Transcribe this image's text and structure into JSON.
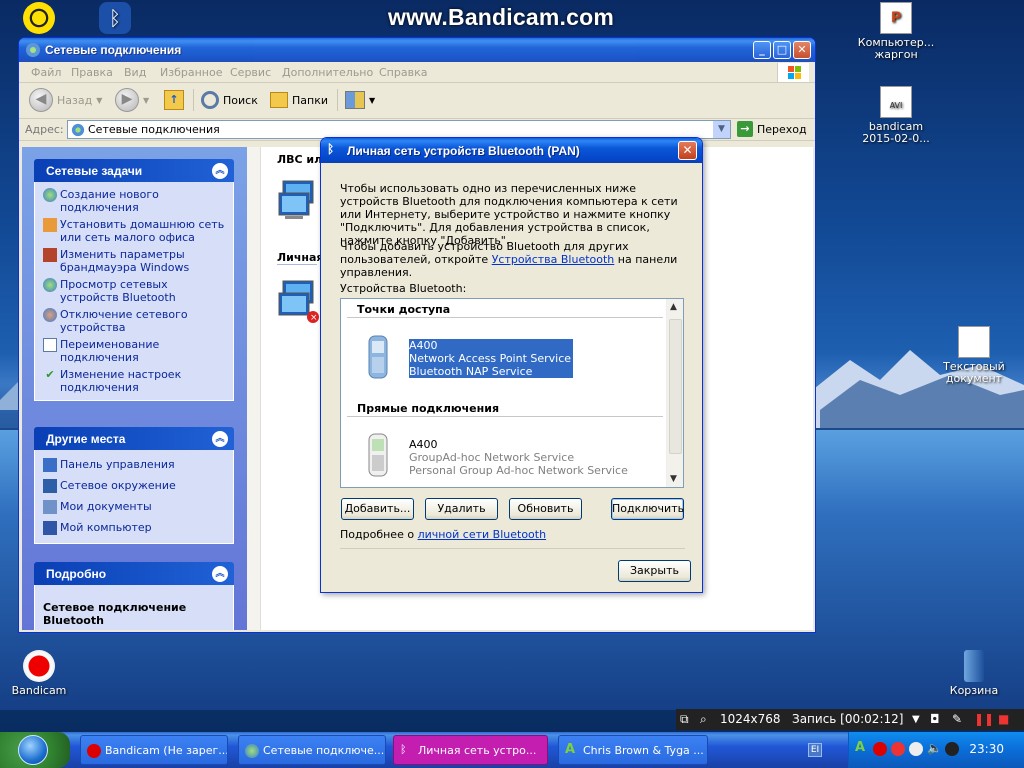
{
  "watermark": "www.Bandicam.com",
  "desktop": {
    "icons": [
      {
        "label": "Компьютер... жаргон"
      },
      {
        "label": "bandicam 2015-02-0..."
      },
      {
        "label": "Текстовый документ"
      },
      {
        "label": "Bandicam"
      },
      {
        "label": "Корзина"
      }
    ]
  },
  "explorer": {
    "title": "Сетевые подключения",
    "menu": [
      "Файл",
      "Правка",
      "Вид",
      "Избранное",
      "Сервис",
      "Дополнительно",
      "Справка"
    ],
    "toolbar": {
      "back": "Назад",
      "search": "Поиск",
      "folders": "Папки"
    },
    "address": {
      "label": "Адрес:",
      "value": "Сетевые подключения",
      "go": "Переход"
    },
    "tasks": {
      "network_tasks_title": "Сетевые задачи",
      "network_tasks": [
        "Создание нового подключения",
        "Установить домашнюю сеть или сеть малого офиса",
        "Изменить параметры брандмауэра Windows",
        "Просмотр сетевых устройств Bluetooth",
        "Отключение сетевого устройства",
        "Переименование подключения",
        "Изменение настроек подключения"
      ],
      "other_places_title": "Другие места",
      "other_places": [
        "Панель управления",
        "Сетевое окружение",
        "Мои документы",
        "Мой компьютер"
      ],
      "details_title": "Подробно",
      "details_name": "Сетевое подключение Bluetooth"
    },
    "groups": [
      "ЛВС или",
      "Личная"
    ]
  },
  "dialog": {
    "title": "Личная сеть устройств Bluetooth (PAN)",
    "intro": "Чтобы использовать одно из перечисленных ниже устройств Bluetooth для подключения компьютера к сети или Интернету, выберите устройство и нажмите кнопку \"Подключить\".  Для добавления устройства в список, нажмите кнопку \"Добавить\".",
    "add_text_1": "Чтобы добавить устройство Bluetooth для других пользователей, откройте",
    "add_link": "Устройства Bluetooth",
    "add_text_2": "на панели управления.",
    "devices_label": "Устройства Bluetooth:",
    "access_points_header": "Точки доступа",
    "direct_header": "Прямые подключения",
    "devices": [
      {
        "name": "A400",
        "line1": "Network Access Point Service",
        "line2": "Bluetooth NAP Service",
        "selected": true
      },
      {
        "name": "A400",
        "line1": "GroupAd-hoc Network Service",
        "line2": "Personal Group Ad-hoc Network Service",
        "selected": false
      }
    ],
    "buttons": {
      "add": "Добавить...",
      "remove": "Удалить",
      "refresh": "Обновить",
      "connect": "Подключить",
      "close": "Закрыть"
    },
    "more_text": "Подробнее о",
    "more_link": "личной сети Bluetooth"
  },
  "bandicam_bar": {
    "resolution": "1024x768",
    "recording": "Запись [00:02:12]"
  },
  "taskbar": {
    "tasks": [
      {
        "label": "Bandicam (Не зарег..."
      },
      {
        "label": "Сетевые подключе..."
      },
      {
        "label": "Личная сеть устро..."
      },
      {
        "label": "Chris Brown & Tyga ..."
      }
    ],
    "clock": "23:30"
  }
}
